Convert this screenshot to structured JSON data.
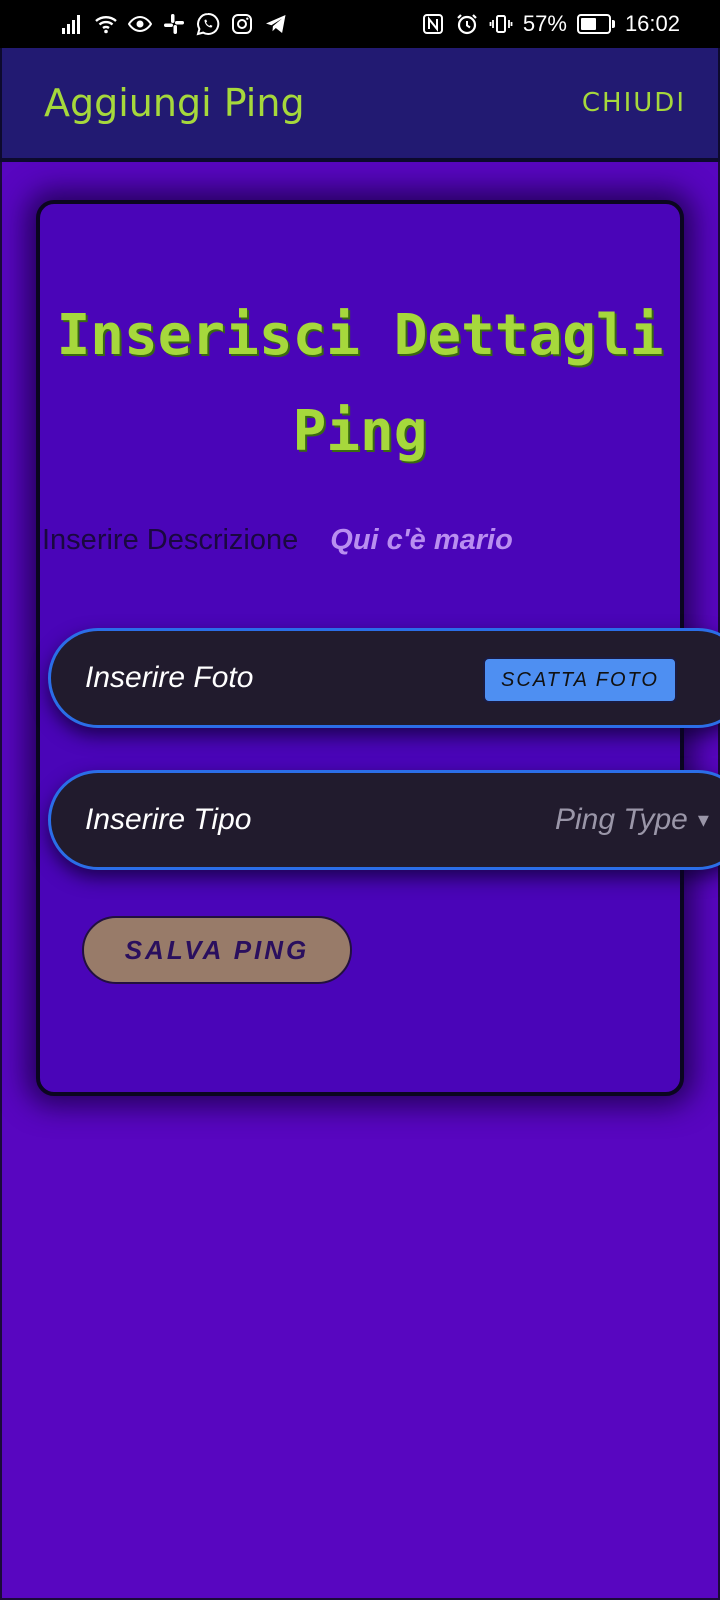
{
  "status_bar": {
    "battery_percent": "57%",
    "battery_level": 0.57,
    "time": "16:02",
    "left_icons": [
      "signal-icon",
      "wifi-icon",
      "eye-icon",
      "slack-icon",
      "whatsapp-icon",
      "instagram-icon",
      "telegram-icon"
    ],
    "right_icons": [
      "nfc-icon",
      "alarm-icon",
      "vibrate-icon",
      "battery-icon"
    ]
  },
  "app_bar": {
    "title": "Aggiungi Ping",
    "close_label": "CHIUDI"
  },
  "card": {
    "title": "Inserisci Dettagli Ping",
    "description_label": "Inserire Descrizione",
    "description_value": "Qui c'è mario",
    "photo_label": "Inserire Foto",
    "photo_button": "SCATTA FOTO",
    "type_label": "Inserire Tipo",
    "type_placeholder": "Ping Type",
    "save_button": "SALVA PING"
  },
  "colors": {
    "background": "#5806c0",
    "app_bar": "#221a72",
    "accent_green": "#a6d83c",
    "card": "#4a05b8",
    "field_border": "#2b6ee8",
    "photo_button": "#4e8ff2",
    "save_button": "#987b69"
  }
}
